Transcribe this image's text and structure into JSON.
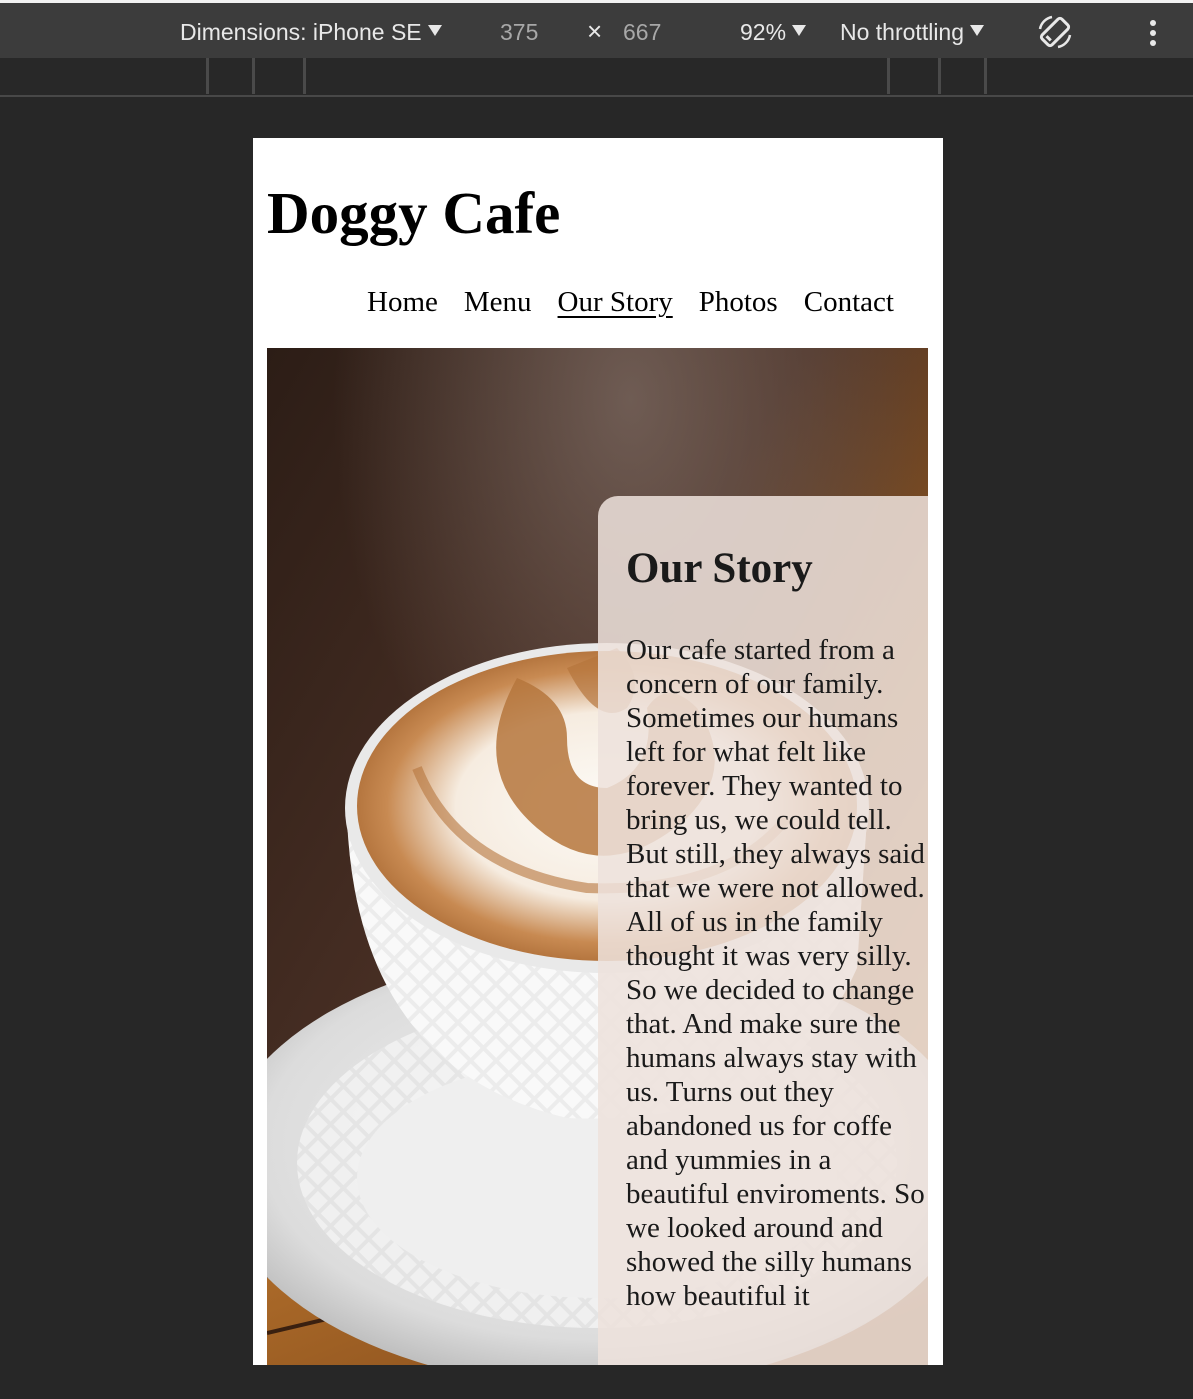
{
  "devtools": {
    "dimensions_label": "Dimensions: iPhone SE",
    "width": "375",
    "times": "×",
    "height": "667",
    "zoom": "92%",
    "throttling": "No throttling",
    "rotate_icon": "rotate-icon",
    "more_icon": "kebab-icon"
  },
  "site": {
    "title": "Doggy Cafe",
    "nav": [
      {
        "label": "Home"
      },
      {
        "label": "Menu"
      },
      {
        "label": "Our Story"
      },
      {
        "label": "Photos"
      },
      {
        "label": "Contact"
      }
    ],
    "active_nav": "Our Story",
    "story": {
      "heading": "Our Story",
      "body": "Our cafe started from a concern of our family. Sometimes our humans left for what felt like forever. They wanted to bring us, we could tell. But still, they always said that we were not allowed. All of us in the family thought it was very silly. So we decided to change that. And make sure the humans always stay with us. Turns out they abandoned us for coffe and yummies in a beautiful enviroments. So we looked around and showed the silly humans how beautiful it"
    }
  }
}
